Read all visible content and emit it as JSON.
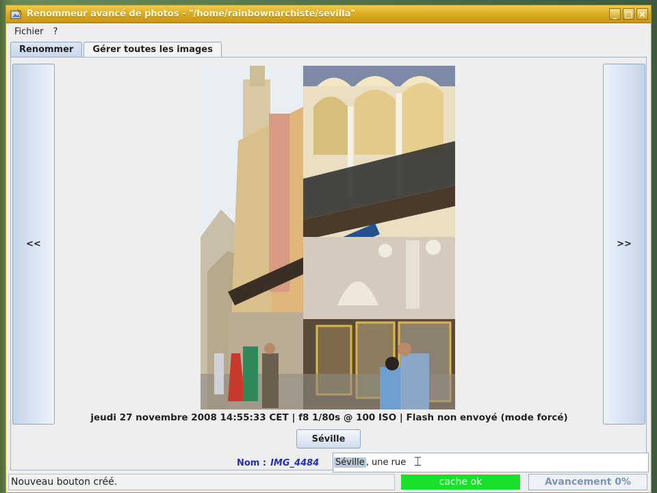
{
  "window": {
    "title": "Renommeur avancé de photos - \"/home/rainbownarchiste/sevilla\"",
    "controls": [
      "_",
      "□",
      "×"
    ]
  },
  "menu": [
    "Fichier",
    "?"
  ],
  "tabs": [
    {
      "label": "Renommer",
      "active": true
    },
    {
      "label": "Gérer toutes les images",
      "active": false
    }
  ],
  "viewer": {
    "prev_label": "<<",
    "next_label": ">>",
    "exif": "jeudi 27 novembre 2008 14:55:33 CET | f8 1/80s @ 100 ISO | Flash non envoyé (mode forcé)",
    "tag_button": "Séville"
  },
  "rename": {
    "label": "Nom :",
    "filename": "IMG_4484",
    "value_selected": "Séville",
    "value_rest": ", une rue"
  },
  "status": {
    "message": "Nouveau bouton créé.",
    "cache": "cache ok",
    "progress_label": "Avancement 0%",
    "progress": 0
  },
  "colors": {
    "titlebar": "#d9a91c",
    "cache_ok": "#19e02b",
    "name_label": "#2230b8"
  }
}
